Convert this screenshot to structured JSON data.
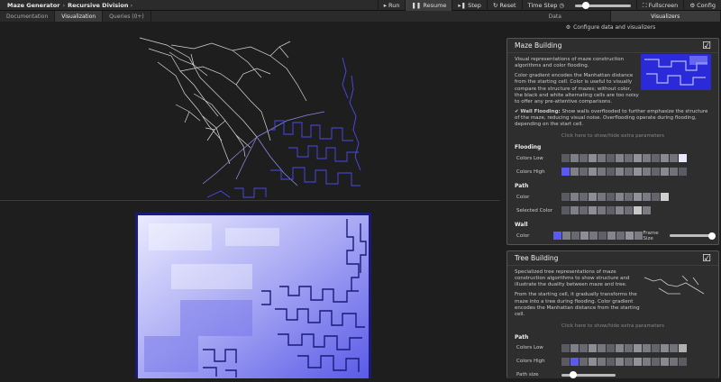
{
  "topbar": {
    "title": "Maze Generator",
    "breadcrumb": "Recursive Division",
    "run": "Run",
    "resume": "Resume",
    "step": "Step",
    "reset": "Reset",
    "time_step": "Time Step",
    "time_step_fraction": 0.2,
    "fullscreen": "Fullscreen",
    "config": "Config"
  },
  "left_tabs": [
    "Documentation",
    "Visualization",
    "Queries (0+)"
  ],
  "right_tabs": [
    "Data",
    "Visualizers"
  ],
  "config_link": "Configure data and visualizers",
  "maze_building": {
    "title": "Maze Building",
    "desc1": "Visual representations of maze construction algorithms and color flooding.",
    "desc2": "Color gradient encodes the Manhattan distance from the starting cell. Color is useful to visually compare the structure of mazes; without color, the black and white alternating cells are too noisy to offer any pre-attentive comparisons.",
    "wall_flooding_label": "Wall Flooding:",
    "wall_flooding_text": "Show walls overflooded to further emphasize the structure of the maze, reducing visual noise. Overflooding operate during flooding, depending on the start cell.",
    "params_link": "Click here to show/hide extra parameters",
    "flooding": "Flooding",
    "colors_low": "Colors Low",
    "colors_high": "Colors High",
    "path": "Path",
    "color": "Color",
    "selected_color": "Selected Color",
    "wall": "Wall",
    "wall_color": "Color",
    "frame_size": "Frame Size",
    "frame_size_fraction": 0.85
  },
  "tree_building": {
    "title": "Tree Building",
    "desc1": "Specialized tree representations of maze construction algorithms to show structure and illustrate the duality between maze and tree.",
    "desc2": "From the starting cell, it gradually transforms the maze into a tree during flooding. Color gradient encodes the Manhattan distance from the starting cell.",
    "params_link": "Click here to show/hide extra parameters",
    "path": "Path",
    "colors_low": "Colors Low",
    "colors_high": "Colors High",
    "path_size": "Path size",
    "path_size_fraction": 0.22
  },
  "colors": {
    "accent": "#5a5af0",
    "maze_light": "#e8e8ff",
    "maze_dark": "#22229a"
  }
}
